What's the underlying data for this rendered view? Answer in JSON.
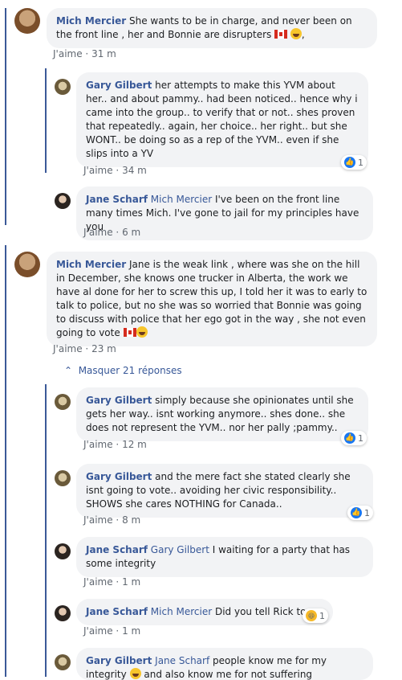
{
  "comments": [
    {
      "author": "Mich Mercier",
      "text": " She wants to be in charge, and never been on the front line , her and Bonnie are disrupters ",
      "text_end": ",",
      "like": "J'aime",
      "time": "31 m"
    },
    {
      "author": "Gary Gilbert",
      "text": " her attempts to make this YVM about her.. and about pammy.. had been noticed.. hence why i came into the group.. to verify that or not.. shes proven that repeatedly.. again, her choice.. her right.. but she WONT.. be doing so as a rep of the YVM.. even if she slips into a YV",
      "like": "J'aime",
      "time": "34 m",
      "reactions": "1"
    },
    {
      "author": "Jane Scharf",
      "mention": "Mich Mercier",
      "text": " I've been on the front line many times Mich. I've gone to jail for my principles have you",
      "like": "J'aime",
      "time": "6 m"
    },
    {
      "author": "Mich Mercier",
      "text": " Jane is the weak link , where was she on the hill in December, she knows one trucker in Alberta, the work we have al done for her to screw this up, I told her it was to early to talk to police, but no she was so worried that Bonnie was going to discuss with police that her ego got in the way , she not even going to vote",
      "like": "J'aime",
      "time": "23 m"
    },
    {
      "author": "Gary Gilbert",
      "text": " simply because she opinionates until she gets her way.. isnt working anymore.. shes done.. she does not represent the YVM.. nor her pally ;pammy..",
      "like": "J'aime",
      "time": "12 m",
      "reactions": "1"
    },
    {
      "author": "Gary Gilbert",
      "text": " and the mere fact she stated clearly she isnt going to vote.. avoiding her civic responsibility.. SHOWS she cares NOTHING for Canada..",
      "like": "J'aime",
      "time": "8 m",
      "reactions": "1"
    },
    {
      "author": "Jane Scharf",
      "mention": "Gary Gilbert",
      "text": " I waiting for a party that has some integrity",
      "like": "J'aime",
      "time": "1 m"
    },
    {
      "author": "Jane Scharf",
      "mention": "Mich Mercier",
      "text": " Did you tell Rick to.",
      "like": "J'aime",
      "time": "1 m",
      "reactions": "1"
    },
    {
      "author": "Gary Gilbert",
      "mention": "Jane Scharf",
      "text": " people know me for my integrity",
      "text2": " and also know me for not suffering foolishness.. "
    }
  ],
  "hide_replies": "Masquer 21 réponses",
  "colors": {
    "link": "#385898",
    "bubble": "#f2f3f5",
    "like_blue": "#1877f2"
  }
}
